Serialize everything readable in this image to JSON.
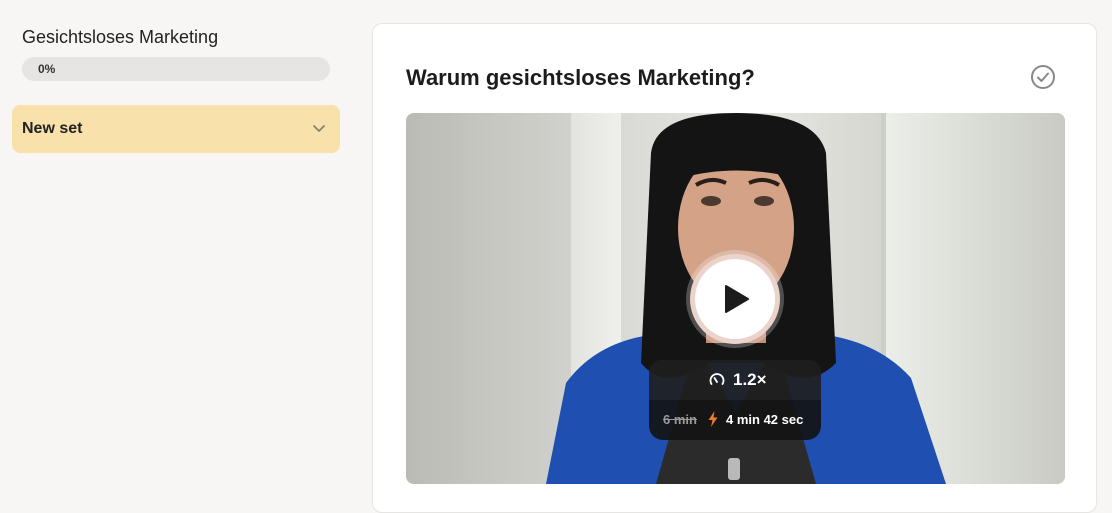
{
  "sidebar": {
    "course_title": "Gesichtsloses Marketing",
    "progress_label": "0%",
    "progress_fraction": 0,
    "sets": [
      {
        "label": "New set",
        "icon": "chevron-down-icon"
      }
    ]
  },
  "lesson": {
    "title": "Warum gesichtsloses Marketing?",
    "complete_icon": "check-circle-icon",
    "video": {
      "play_icon": "play-icon",
      "speed_icon": "speedometer-icon",
      "speed": "1.2×",
      "original_duration": "6 min",
      "bolt_icon": "lightning-icon",
      "adjusted_duration": "4 min 42 sec"
    }
  },
  "colors": {
    "accent_set_bg": "#f9e1ab",
    "bolt": "#f07a2a"
  }
}
